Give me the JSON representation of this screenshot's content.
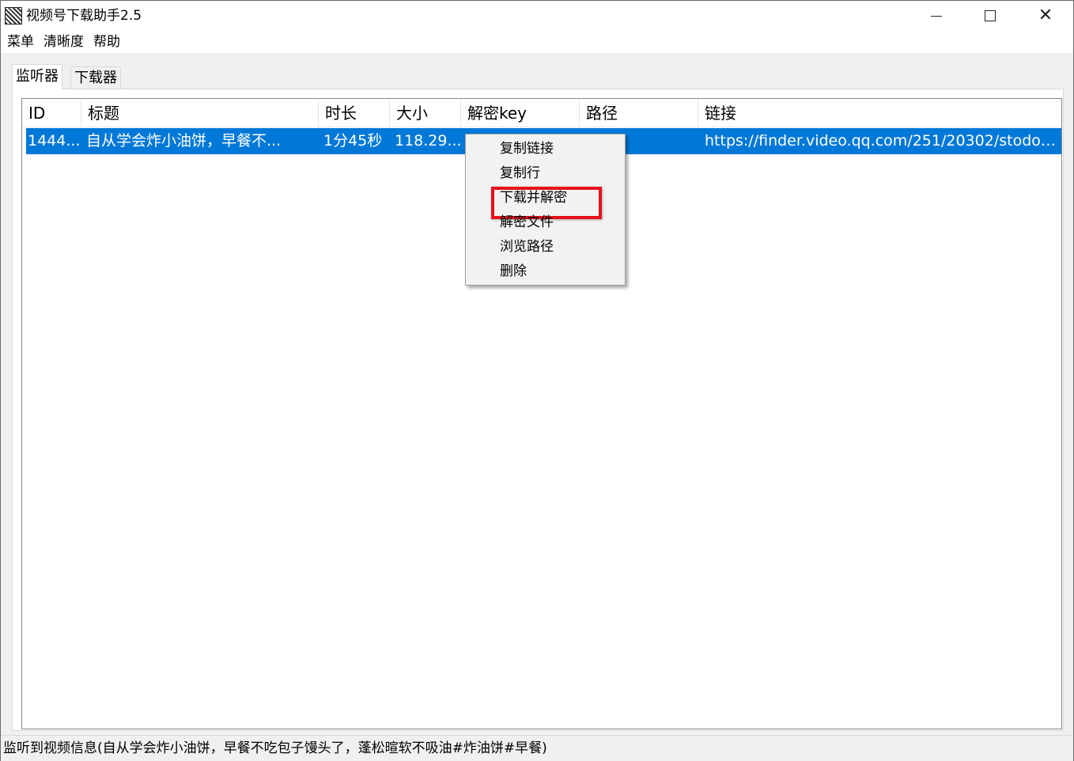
{
  "window": {
    "title": "视频号下载助手2.5",
    "controls": {
      "minimize_icon": "minimize-icon",
      "maximize_icon": "maximize-icon",
      "close_icon": "close-icon"
    }
  },
  "menubar": {
    "items": [
      "菜单",
      "清晰度",
      "帮助"
    ]
  },
  "tabs": [
    {
      "label": "监听器",
      "active": true
    },
    {
      "label": "下载器",
      "active": false
    }
  ],
  "table": {
    "columns": [
      "ID",
      "标题",
      "时长",
      "大小",
      "解密key",
      "路径",
      "链接"
    ],
    "rows": [
      {
        "id": "1444...",
        "title": "自从学会炸小油饼，早餐不...",
        "duration": "1分45秒",
        "size": "118.29...",
        "key": "",
        "path": "",
        "link": "https://finder.video.qq.com/251/20302/stodown...",
        "selected": true
      }
    ]
  },
  "context_menu": {
    "items": [
      "复制链接",
      "复制行",
      "下载并解密",
      "解密文件",
      "浏览路径",
      "删除"
    ],
    "highlighted": "下载并解密"
  },
  "status_bar": {
    "text": "监听到视频信息(自从学会炸小油饼，早餐不吃包子馒头了，蓬松暄软不吸油#炸油饼#早餐)"
  },
  "colors": {
    "selection": "#0078d7",
    "highlight_box": "#e8101c"
  }
}
